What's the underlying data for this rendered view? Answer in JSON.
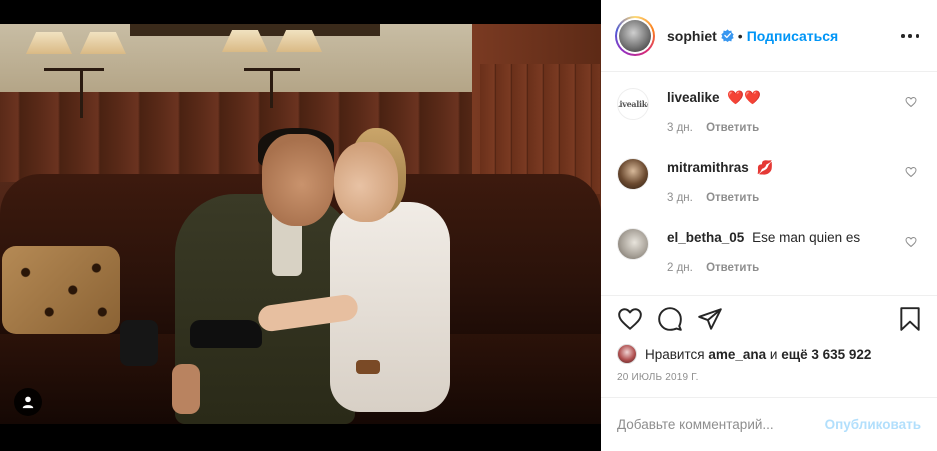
{
  "post": {
    "author": "sophiet",
    "separator": "•",
    "follow_label": "Подписаться",
    "verified": true
  },
  "comments": [
    {
      "user": "livealike",
      "text": "❤️❤️",
      "avatar_text": "Livealike",
      "time": "3 дн.",
      "reply_label": "Ответить"
    },
    {
      "user": "mitramithras",
      "text": "💋",
      "time": "3 дн.",
      "reply_label": "Ответить"
    },
    {
      "user": "el_betha_05",
      "text": "Ese man quien es",
      "time": "2 дн.",
      "reply_label": "Ответить"
    }
  ],
  "likes": {
    "prefix": "Нравится",
    "user": "ame_ana",
    "middle": "и",
    "rest": "ещё 3 635 922"
  },
  "date": "20 ИЮЛЬ 2019 Г.",
  "add_comment": {
    "placeholder": "Добавьте комментарий...",
    "publish_label": "Опубликовать"
  },
  "colors": {
    "accent": "#0095f6",
    "publish_disabled": "#b2dffc",
    "muted": "#8e8e8e",
    "heart": "#e0245e"
  },
  "icons": {
    "user_tag": "user-tag-icon",
    "like": "heart-icon",
    "comment": "comment-icon",
    "share": "share-icon",
    "save": "bookmark-icon",
    "more": "more-icon"
  }
}
